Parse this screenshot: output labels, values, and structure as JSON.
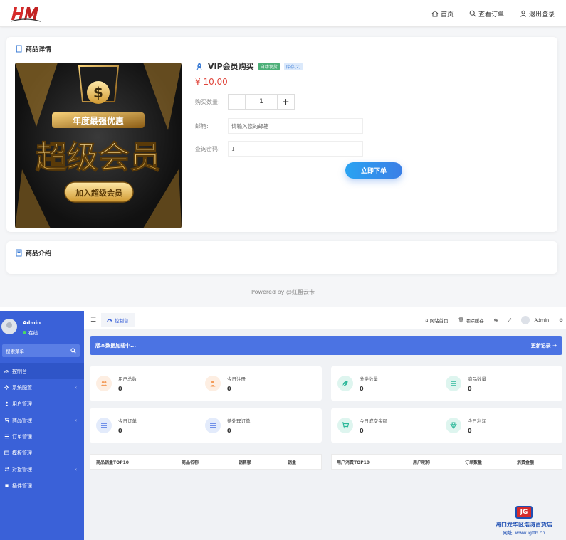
{
  "store": {
    "nav": {
      "home": "首页",
      "orders": "查看订单",
      "logout": "退出登录"
    },
    "product_card_title": "商品详情",
    "product": {
      "name": "VIP会员购买",
      "badge_auto": "自动发货",
      "badge_stock": "库存(2)",
      "price": "¥ 10.00",
      "banner_text_top": "年度最强优惠",
      "banner_text_main": "超级会员",
      "banner_button": "加入超级会员"
    },
    "form": {
      "qty_label": "购买数量:",
      "qty_minus": "-",
      "qty_value": "1",
      "qty_plus": "+",
      "email_label": "邮箱:",
      "email_placeholder": "请输入您的邮箱",
      "pwd_label": "查询密码:",
      "pwd_value": "1",
      "buy_button": "立即下单"
    },
    "intro_title": "商品介绍",
    "powered": "Powered by @红盟云卡"
  },
  "admin": {
    "user": {
      "name": "Admin",
      "status": "在线"
    },
    "search_placeholder": "搜索菜单",
    "menu": [
      {
        "label": "控制台",
        "icon": "dashboard-icon",
        "active": true,
        "chevron": false
      },
      {
        "label": "系统配置",
        "icon": "gear-icon",
        "active": false,
        "chevron": true
      },
      {
        "label": "用户管理",
        "icon": "user-icon",
        "active": false,
        "chevron": false
      },
      {
        "label": "商品管理",
        "icon": "cart-icon",
        "active": false,
        "chevron": true
      },
      {
        "label": "订单管理",
        "icon": "list-icon",
        "active": false,
        "chevron": false
      },
      {
        "label": "模板管理",
        "icon": "template-icon",
        "active": false,
        "chevron": false
      },
      {
        "label": "对接管理",
        "icon": "link-icon",
        "active": false,
        "chevron": true
      },
      {
        "label": "插件管理",
        "icon": "puzzle-icon",
        "active": false,
        "chevron": false
      }
    ],
    "tab": "控制台",
    "topbar": {
      "site_home": "网站首页",
      "clear_cache": "清除缓存",
      "user": "Admin"
    },
    "banner": {
      "left": "版本数据加载中...",
      "right": "更新记录 →"
    },
    "stats": [
      {
        "label": "用户总数",
        "value": "0",
        "icon": "users-icon",
        "color": "#f39c5a",
        "bg": "#fdeee2"
      },
      {
        "label": "今日注册",
        "value": "0",
        "icon": "user-icon",
        "color": "#f39c5a",
        "bg": "#fdeee2"
      },
      {
        "label": "分类数量",
        "value": "0",
        "icon": "leaf-icon",
        "color": "#2cb89a",
        "bg": "#def5ef"
      },
      {
        "label": "商品数量",
        "value": "0",
        "icon": "list-icon",
        "color": "#2cb89a",
        "bg": "#def5ef"
      },
      {
        "label": "今日订单",
        "value": "0",
        "icon": "list-icon",
        "color": "#4b73e3",
        "bg": "#e3ebfb"
      },
      {
        "label": "待处理订单",
        "value": "0",
        "icon": "list-icon",
        "color": "#4b73e3",
        "bg": "#e3ebfb"
      },
      {
        "label": "今日成交金额",
        "value": "0",
        "icon": "cart-icon",
        "color": "#2cb89a",
        "bg": "#def5ef"
      },
      {
        "label": "今日利润",
        "value": "0",
        "icon": "diamond-icon",
        "color": "#2cb89a",
        "bg": "#def5ef"
      }
    ],
    "table_left": [
      "商品销量TOP10",
      "商品名称",
      "销售额",
      "销量"
    ],
    "table_right": [
      "用户消费TOP10",
      "用户昵称",
      "订单数量",
      "消费金额"
    ]
  },
  "watermark": {
    "logo": "JG",
    "name": "海口龙华区浩涛百货店",
    "url": "网址: www.igftb.cn"
  }
}
